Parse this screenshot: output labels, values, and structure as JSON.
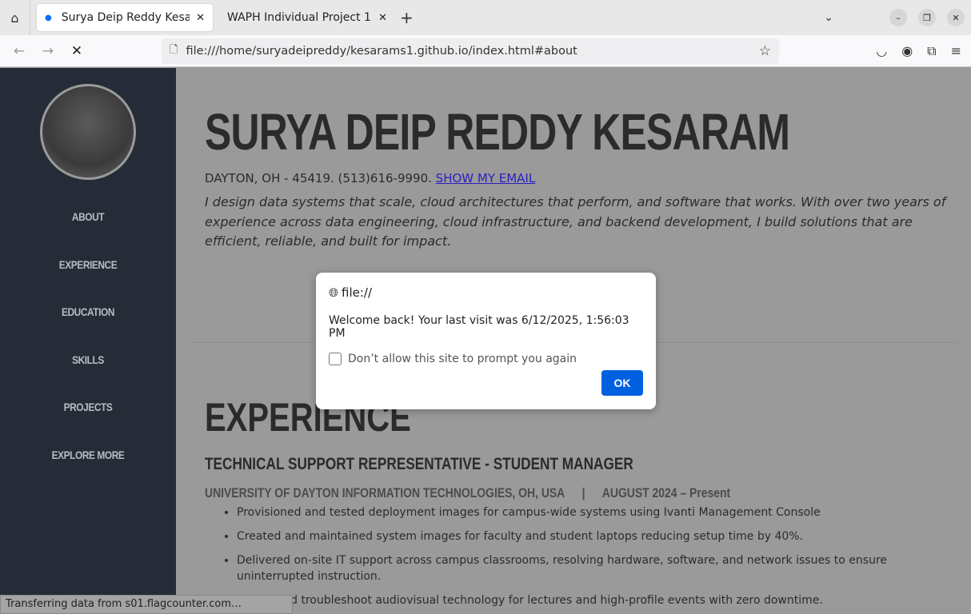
{
  "browser": {
    "tabs": [
      {
        "title": "Surya Deip Reddy Kesaram",
        "active": true
      },
      {
        "title": "WAPH Individual Project 1",
        "active": false
      }
    ],
    "url": "file:///home/suryadeipreddy/kesarams1.github.io/index.html#about",
    "status": "Transferring data from s01.flagcounter.com…"
  },
  "sidebar": {
    "items": [
      "ABOUT",
      "EXPERIENCE",
      "EDUCATION",
      "SKILLS",
      "PROJECTS",
      "EXPLORE MORE"
    ]
  },
  "about": {
    "name": "SURYA DEIP REDDY KESARAM",
    "contact": "DAYTON, OH - 45419. (513)616-9990.",
    "email_link": "SHOW MY EMAIL",
    "bio": "I design data systems that scale, cloud architectures that perform, and software that works. With over two years of experience across data engineering, cloud infrastructure, and backend development, I build solutions that are efficient, reliable, and built for impact."
  },
  "experience": {
    "heading": "EXPERIENCE",
    "title": "TECHNICAL SUPPORT REPRESENTATIVE - STUDENT MANAGER",
    "org": "UNIVERSITY OF DAYTON INFORMATION TECHNOLOGIES, OH, USA",
    "separator": "|",
    "dates": "AUGUST 2024 – Present",
    "bullets": [
      "Provisioned and tested deployment images for campus-wide systems using Ivanti Management Console",
      "Created and maintained system images for faculty and student laptops reducing setup time by 40%.",
      "Delivered on-site IT support across campus classrooms, resolving hardware, software, and network issues to ensure uninterrupted instruction.",
      "Set up and troubleshoot audiovisual technology for lectures and high-profile events with zero downtime."
    ]
  },
  "dialog": {
    "origin": "file://",
    "message": "Welcome back! Your last visit was 6/12/2025, 1:56:03 PM",
    "checkbox": "Don’t allow this site to prompt you again",
    "ok": "OK"
  }
}
